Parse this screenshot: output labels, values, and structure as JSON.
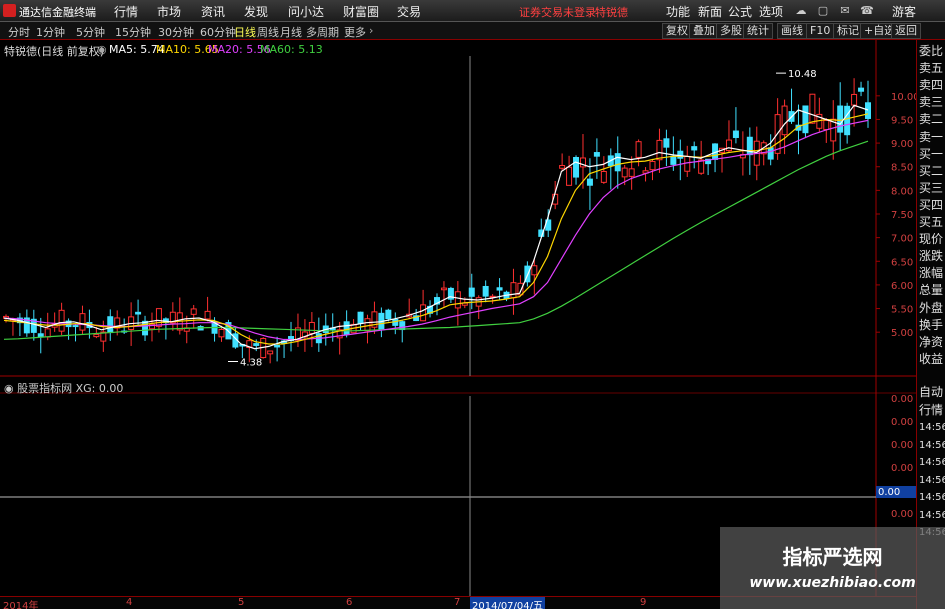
{
  "app": {
    "title": "通达信金融终端"
  },
  "menu": [
    "行情",
    "市场",
    "资讯",
    "发现",
    "问小达",
    "财富圈",
    "交易"
  ],
  "notice": "证券交易未登录",
  "notice_stock": "特锐德",
  "right_menu": [
    "功能",
    "新面",
    "公式",
    "选项"
  ],
  "user": "游客",
  "period_tabs": [
    "分时",
    "1分钟",
    "5分钟",
    "15分钟",
    "30分钟",
    "60分钟",
    "日线",
    "周线",
    "月线",
    "多周期",
    "更多"
  ],
  "active_period": "日线",
  "toolbar": [
    "复权",
    "叠加",
    "多股",
    "统计",
    "画线",
    "F10",
    "标记",
    "+自选",
    "返回"
  ],
  "stock_label": "特锐德(日线 前复权)",
  "ma_legend": [
    {
      "label": "MA5: 5.74",
      "color": "#ffffff"
    },
    {
      "label": "MA10: 5.65",
      "color": "#ffd700"
    },
    {
      "label": "MA20: 5.56",
      "color": "#e040ff"
    },
    {
      "label": "MA60: 5.13",
      "color": "#40d040"
    }
  ],
  "sub_legend": "股票指标网 XG: 0.00",
  "right_panel": [
    "委比",
    "卖五",
    "卖四",
    "卖三",
    "卖二",
    "卖一",
    "买一",
    "买二",
    "买三",
    "买四",
    "买五",
    "现价",
    "涨跌",
    "涨幅",
    "总量",
    "外盘",
    "换手",
    "净资",
    "收益"
  ],
  "right_panel_sub": [
    "自动",
    "行情",
    "14:56",
    "14:56",
    "14:56",
    "14:56",
    "14:56",
    "14:56",
    "14:56"
  ],
  "watermark": {
    "line1": "指标严选网",
    "line2": "www.xuezhibiao.com"
  },
  "chart_data": {
    "type": "candlestick",
    "ylim": [
      4.2,
      10.8
    ],
    "yticks": [
      "10.00",
      "9.50",
      "9.00",
      "8.50",
      "8.00",
      "7.50",
      "7.00",
      "6.50",
      "6.00",
      "5.50",
      "5.00"
    ],
    "annotations": [
      {
        "label": "10.48",
        "type": "high"
      },
      {
        "label": "4.38",
        "type": "low"
      }
    ],
    "x_labels": [
      "2014年",
      "4",
      "5",
      "6",
      "7",
      "8",
      "9"
    ],
    "cursor_date": "2014/07/04/五",
    "sub_yticks": [
      "0.00",
      "0.00",
      "0.00",
      "0.00",
      "0.00",
      "0.00"
    ],
    "sub_value": "0.00",
    "ma5": [
      5.3,
      5.25,
      5.18,
      5.1,
      5.2,
      5.22,
      5.15,
      5.05,
      5.12,
      5.18,
      5.2,
      5.25,
      5.22,
      5.28,
      5.3,
      5.22,
      5.05,
      4.75,
      4.65,
      4.7,
      4.8,
      4.85,
      4.95,
      5.05,
      5.12,
      5.15,
      5.2,
      5.22,
      5.28,
      5.35,
      5.45,
      5.6,
      5.75,
      5.7,
      5.68,
      5.72,
      5.78,
      5.82,
      6.5,
      7.4,
      8.4,
      8.6,
      8.5,
      8.55,
      8.7,
      8.65,
      8.7,
      8.8,
      8.75,
      8.72,
      8.68,
      8.8,
      8.9,
      8.85,
      8.8,
      9.0,
      9.4,
      9.7,
      9.6,
      9.5,
      9.4,
      9.8,
      9.7
    ],
    "ma10": [
      5.25,
      5.22,
      5.18,
      5.15,
      5.15,
      5.18,
      5.18,
      5.12,
      5.1,
      5.12,
      5.16,
      5.2,
      5.22,
      5.24,
      5.26,
      5.25,
      5.15,
      4.95,
      4.8,
      4.75,
      4.75,
      4.8,
      4.88,
      4.95,
      5.02,
      5.08,
      5.13,
      5.18,
      5.22,
      5.28,
      5.35,
      5.45,
      5.58,
      5.62,
      5.64,
      5.66,
      5.7,
      5.75,
      6.05,
      6.6,
      7.4,
      8.0,
      8.35,
      8.45,
      8.55,
      8.6,
      8.62,
      8.68,
      8.72,
      8.72,
      8.7,
      8.74,
      8.8,
      8.84,
      8.84,
      8.9,
      9.1,
      9.35,
      9.45,
      9.5,
      9.48,
      9.55,
      9.62
    ],
    "ma20": [
      5.3,
      5.28,
      5.24,
      5.2,
      5.18,
      5.17,
      5.16,
      5.14,
      5.12,
      5.12,
      5.13,
      5.15,
      5.17,
      5.18,
      5.2,
      5.2,
      5.17,
      5.08,
      4.98,
      4.9,
      4.85,
      4.84,
      4.86,
      4.88,
      4.92,
      4.96,
      5.0,
      5.04,
      5.08,
      5.12,
      5.17,
      5.24,
      5.32,
      5.38,
      5.44,
      5.5,
      5.55,
      5.6,
      5.75,
      6.05,
      6.55,
      7.05,
      7.5,
      7.85,
      8.1,
      8.25,
      8.35,
      8.45,
      8.52,
      8.58,
      8.62,
      8.66,
      8.7,
      8.75,
      8.78,
      8.82,
      8.92,
      9.05,
      9.18,
      9.28,
      9.36,
      9.42,
      9.48
    ],
    "ma60": [
      4.85,
      4.86,
      4.88,
      4.9,
      4.92,
      4.94,
      4.96,
      4.98,
      5.0,
      5.02,
      5.04,
      5.06,
      5.07,
      5.08,
      5.09,
      5.1,
      5.1,
      5.09,
      5.08,
      5.07,
      5.06,
      5.05,
      5.04,
      5.03,
      5.03,
      5.03,
      5.04,
      5.05,
      5.06,
      5.07,
      5.08,
      5.09,
      5.1,
      5.12,
      5.14,
      5.16,
      5.18,
      5.2,
      5.28,
      5.4,
      5.55,
      5.72,
      5.9,
      6.08,
      6.26,
      6.44,
      6.62,
      6.8,
      6.98,
      7.15,
      7.32,
      7.48,
      7.64,
      7.8,
      7.96,
      8.12,
      8.28,
      8.44,
      8.58,
      8.72,
      8.84,
      8.94,
      9.04
    ]
  }
}
